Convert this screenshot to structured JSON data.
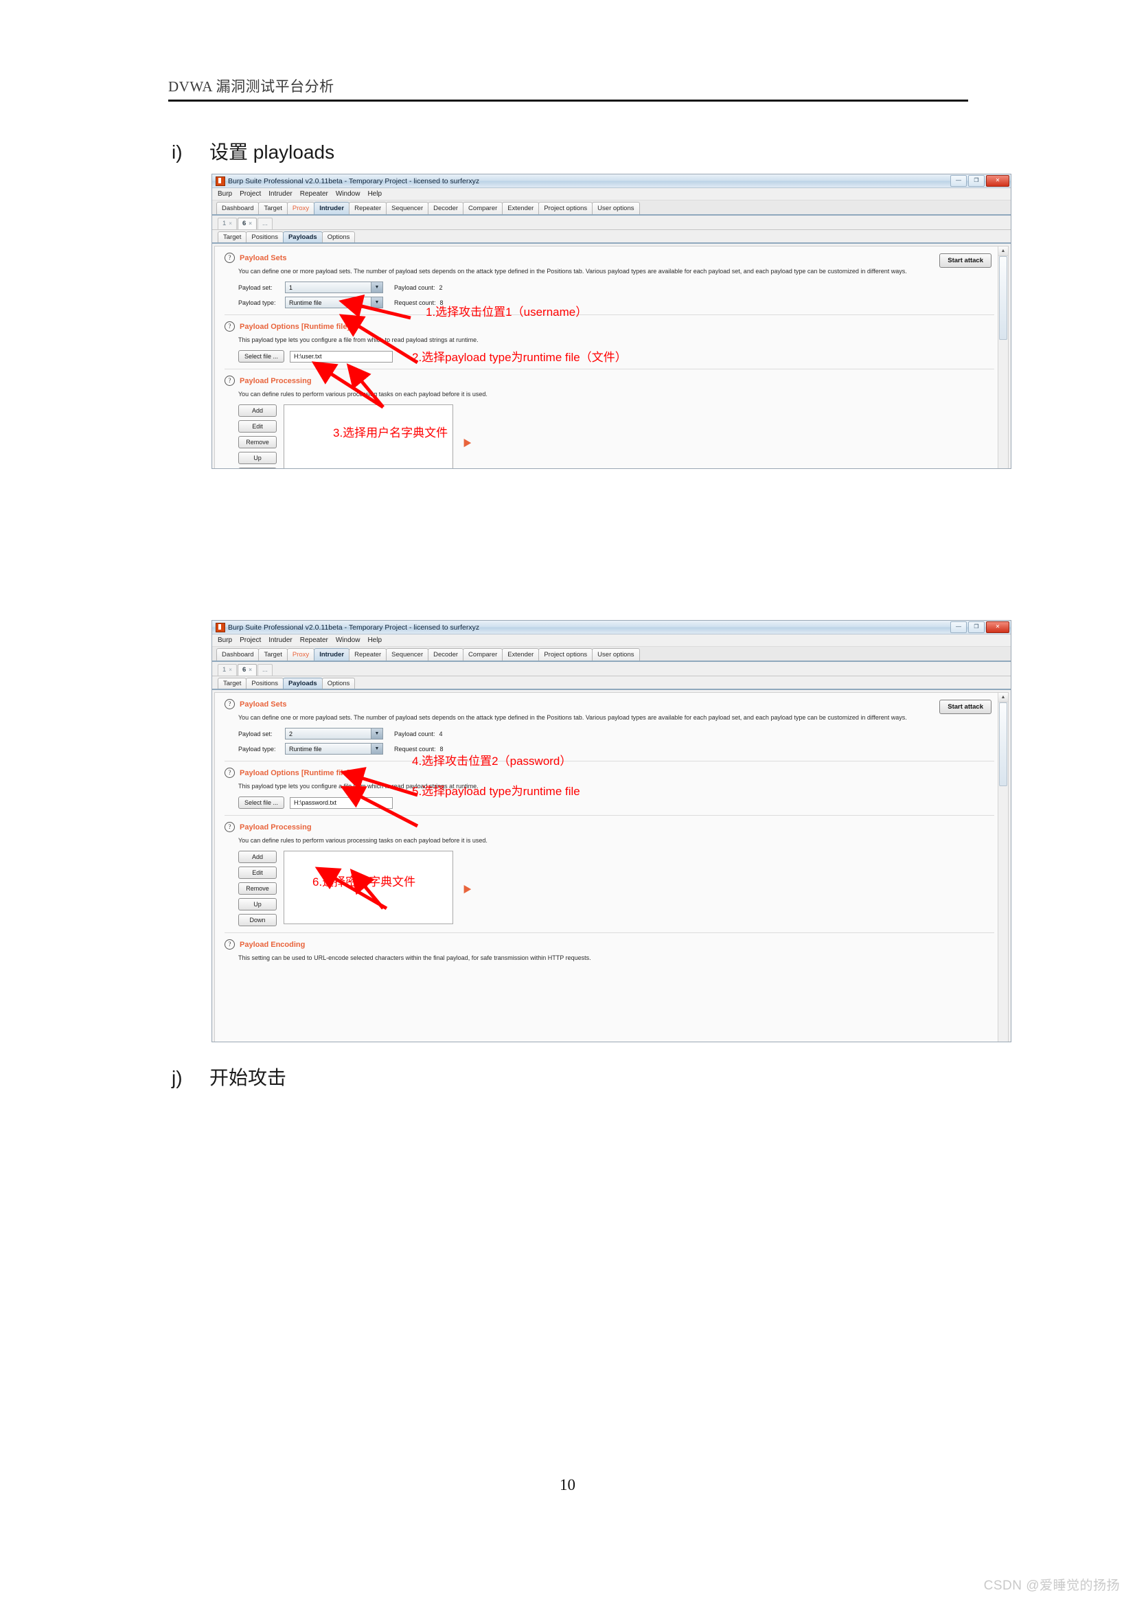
{
  "document": {
    "header_text": "DVWA 漏洞测试平台分析",
    "page_number": "10",
    "watermark": "CSDN @爱睡觉的扬扬",
    "headings": [
      {
        "marker": "i)",
        "text": "设置 playloads"
      },
      {
        "marker": "j)",
        "text": "开始攻击"
      }
    ]
  },
  "burp": {
    "title": "Burp Suite Professional v2.0.11beta - Temporary Project - licensed to surferxyz",
    "window_buttons": {
      "minimize": "—",
      "maximize": "❐",
      "close": "✕"
    },
    "menu": [
      "Burp",
      "Project",
      "Intruder",
      "Repeater",
      "Window",
      "Help"
    ],
    "main_tabs": [
      "Dashboard",
      "Target",
      "Proxy",
      "Intruder",
      "Repeater",
      "Sequencer",
      "Decoder",
      "Comparer",
      "Extender",
      "Project options",
      "User options"
    ],
    "main_tab_active": "Intruder",
    "main_tab_highlight": "Proxy",
    "attack_tabs": [
      {
        "label": "1",
        "close": "×"
      },
      {
        "label": "6",
        "close": "×"
      },
      {
        "label": "...",
        "close": ""
      }
    ],
    "attack_tab_active": "6",
    "sub_tabs": [
      "Target",
      "Positions",
      "Payloads",
      "Options"
    ],
    "sub_tab_active": "Payloads",
    "start_attack_label": "Start attack",
    "sections": {
      "payload_sets": {
        "title": "Payload Sets",
        "description": "You can define one or more payload sets. The number of payload sets depends on the attack type defined in the Positions tab. Various payload types are available for each payload set, and each payload type can be customized in different ways.",
        "payload_set_label": "Payload set:",
        "payload_type_label": "Payload type:",
        "payload_count_label": "Payload count:",
        "request_count_label": "Request count:"
      },
      "payload_options": {
        "title": "Payload Options [Runtime file]",
        "description": "This payload type lets you configure a file from which to read payload strings at runtime.",
        "select_file_label": "Select file ..."
      },
      "payload_processing": {
        "title": "Payload Processing",
        "description": "You can define rules to perform various processing tasks on each payload before it is used.",
        "buttons": [
          "Add",
          "Edit",
          "Remove",
          "Up",
          "Down"
        ]
      },
      "payload_encoding": {
        "title": "Payload Encoding",
        "description": "This setting can be used to URL-encode selected characters within the final payload, for safe transmission within HTTP requests."
      }
    }
  },
  "screenshot_1": {
    "payload_set_value": "1",
    "payload_type_value": "Runtime file",
    "payload_count_value": "2",
    "request_count_value": "8",
    "file_path": "H:\\user.txt",
    "annotations": [
      {
        "id": "a1",
        "text": "1.选择攻击位置1（username）"
      },
      {
        "id": "a2",
        "text": "2.选择payload type为runtime file（文件）"
      },
      {
        "id": "a3",
        "text": "3.选择用户名字典文件"
      }
    ]
  },
  "screenshot_2": {
    "payload_set_value": "2",
    "payload_type_value": "Runtime file",
    "payload_count_value": "4",
    "request_count_value": "8",
    "file_path": "H:\\password.txt",
    "annotations": [
      {
        "id": "a4",
        "text": "4.选择攻击位置2（password）"
      },
      {
        "id": "a5",
        "text": "5.选择payload type为runtime file"
      },
      {
        "id": "a6",
        "text": "6.选择密码字典文件"
      }
    ]
  },
  "colors": {
    "annotation_red": "#ff0000",
    "burp_orange": "#e8643c",
    "title_blue": "#10243a"
  }
}
